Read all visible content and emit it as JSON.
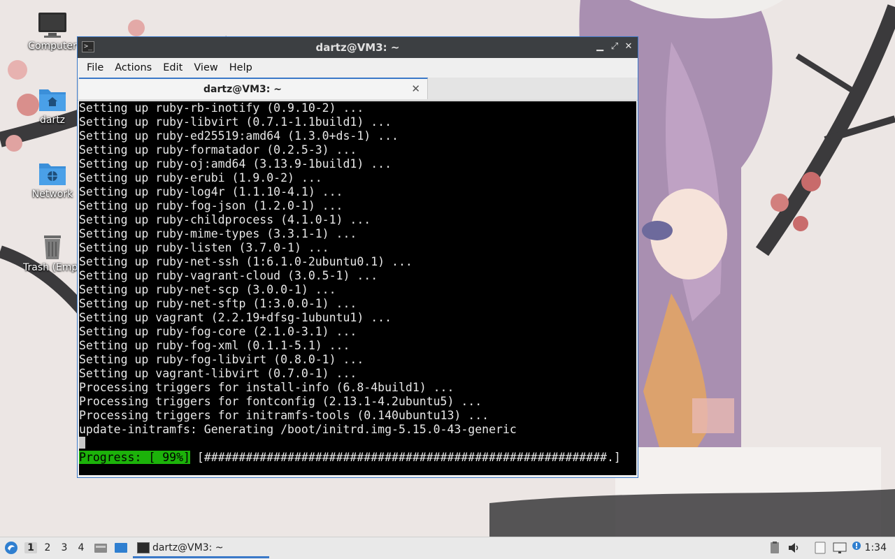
{
  "desktop": {
    "icons": [
      {
        "label": "Computer"
      },
      {
        "label": "dartz"
      },
      {
        "label": "Network"
      },
      {
        "label": "Trash (Empty)"
      }
    ]
  },
  "window": {
    "title": "dartz@VM3: ~",
    "menu": [
      "File",
      "Actions",
      "Edit",
      "View",
      "Help"
    ],
    "tab_label": "dartz@VM3: ~",
    "tab_close": "✕",
    "terminal_lines": [
      "Setting up ruby-rb-inotify (0.9.10-2) ...",
      "Setting up ruby-libvirt (0.7.1-1.1build1) ...",
      "Setting up ruby-ed25519:amd64 (1.3.0+ds-1) ...",
      "Setting up ruby-formatador (0.2.5-3) ...",
      "Setting up ruby-oj:amd64 (3.13.9-1build1) ...",
      "Setting up ruby-erubi (1.9.0-2) ...",
      "Setting up ruby-log4r (1.1.10-4.1) ...",
      "Setting up ruby-fog-json (1.2.0-1) ...",
      "Setting up ruby-childprocess (4.1.0-1) ...",
      "Setting up ruby-mime-types (3.3.1-1) ...",
      "Setting up ruby-listen (3.7.0-1) ...",
      "Setting up ruby-net-ssh (1:6.1.0-2ubuntu0.1) ...",
      "Setting up ruby-vagrant-cloud (3.0.5-1) ...",
      "Setting up ruby-net-scp (3.0.0-1) ...",
      "Setting up ruby-net-sftp (1:3.0.0-1) ...",
      "Setting up vagrant (2.2.19+dfsg-1ubuntu1) ...",
      "Setting up ruby-fog-core (2.1.0-3.1) ...",
      "Setting up ruby-fog-xml (0.1.1-5.1) ...",
      "Setting up ruby-fog-libvirt (0.8.0-1) ...",
      "Setting up vagrant-libvirt (0.7.0-1) ...",
      "Processing triggers for install-info (6.8-4build1) ...",
      "Processing triggers for fontconfig (2.13.1-4.2ubuntu5) ...",
      "Processing triggers for initramfs-tools (0.140ubuntu13) ...",
      "update-initramfs: Generating /boot/initrd.img-5.15.0-43-generic"
    ],
    "progress_label": "Progress: [ 99%]",
    "progress_bar": " [##########################################################.]",
    "progress_percent": 99
  },
  "taskbar": {
    "workspaces": [
      "1",
      "2",
      "3",
      "4"
    ],
    "active_workspace": "1",
    "task_label": "dartz@VM3: ~",
    "clock": "1:34"
  },
  "colors": {
    "accent": "#3a78c8",
    "progress_green": "#1cb20a",
    "terminal_bg": "#000000",
    "titlebar_bg": "#3c3f42"
  }
}
